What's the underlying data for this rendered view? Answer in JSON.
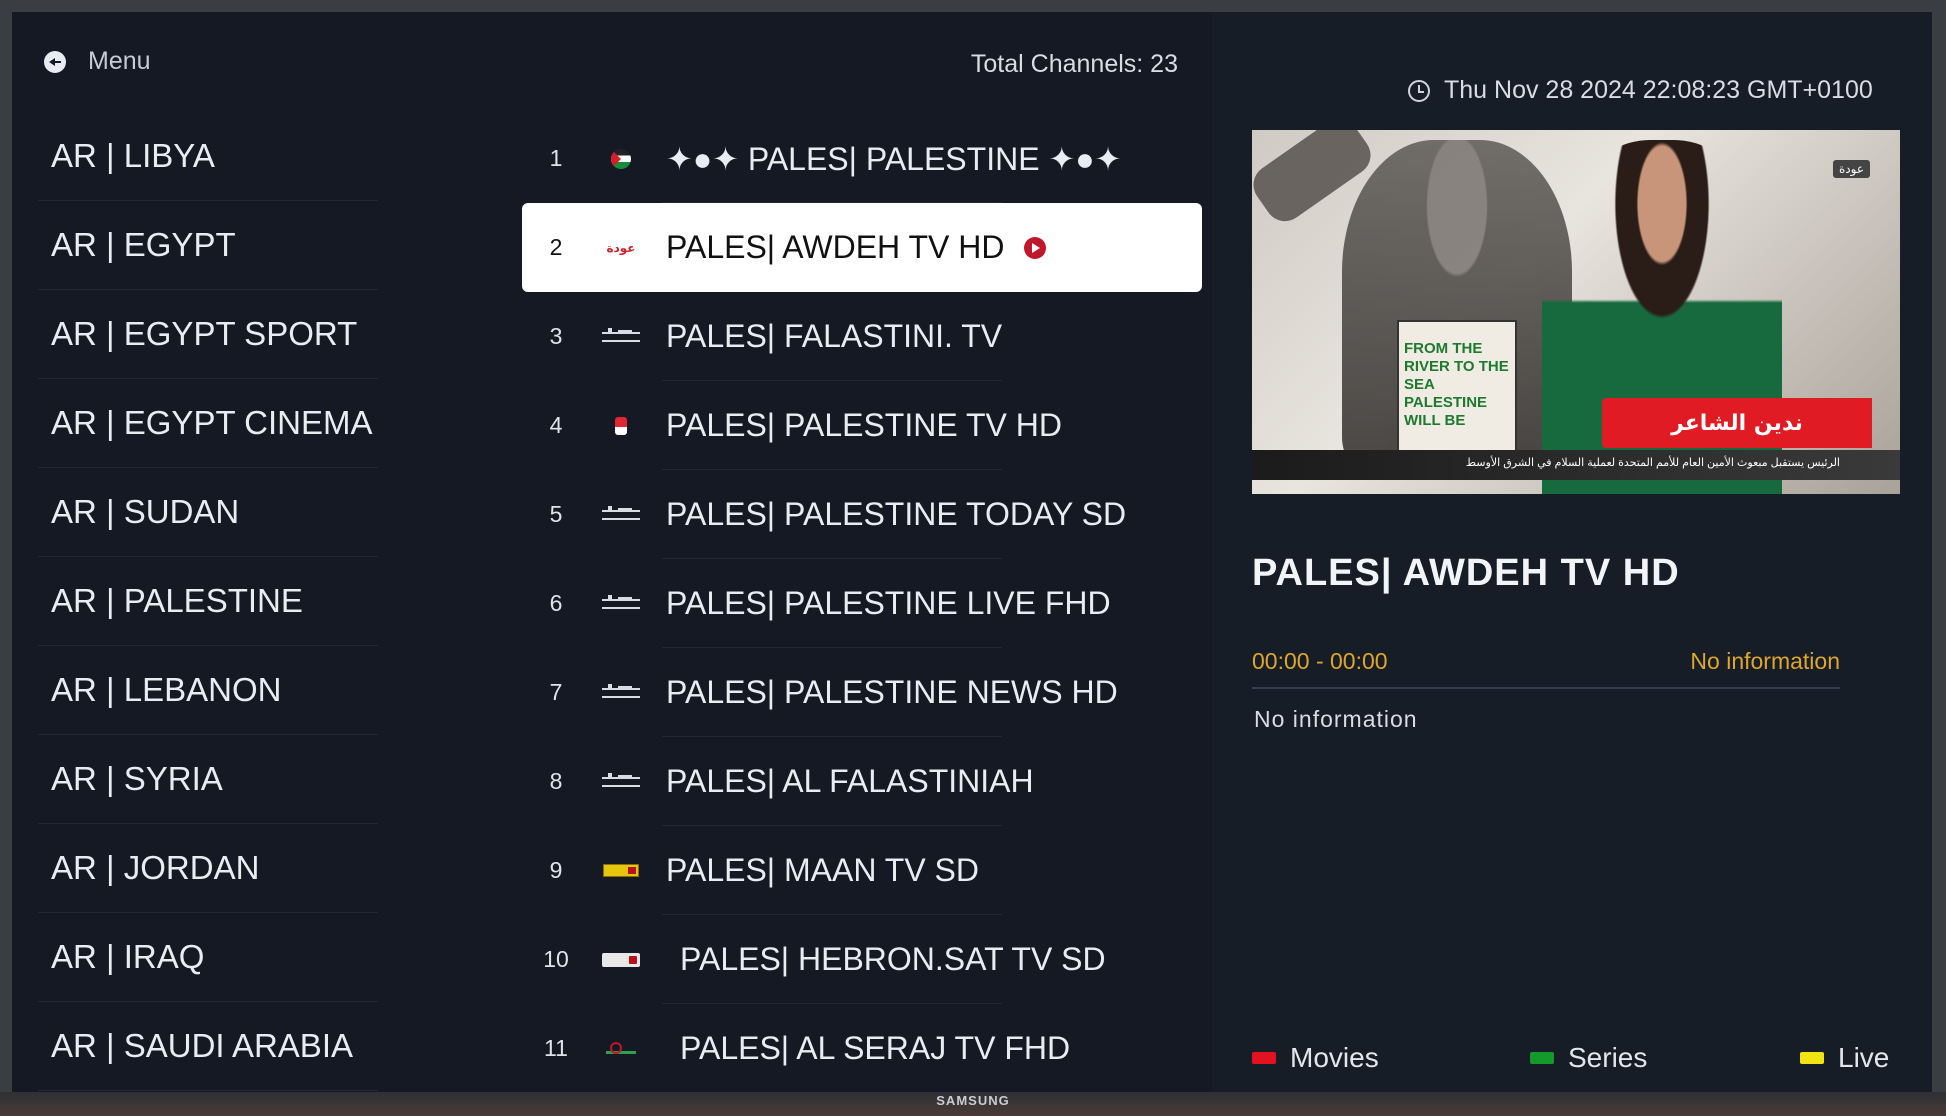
{
  "colors": {
    "movies": "#e3121f",
    "series": "#139a2a",
    "live": "#f2e312",
    "play": "#c0182a",
    "accent_time": "#e0a62b"
  },
  "bezel": {
    "brand": "SAMSUNG"
  },
  "categories": {
    "menu_label": "Menu",
    "items": [
      {
        "label": "AR | LIBYA"
      },
      {
        "label": "AR | EGYPT"
      },
      {
        "label": "AR | EGYPT SPORT"
      },
      {
        "label": "AR | EGYPT CINEMA"
      },
      {
        "label": "AR | SUDAN"
      },
      {
        "label": "AR | PALESTINE"
      },
      {
        "label": "AR | LEBANON"
      },
      {
        "label": "AR | SYRIA"
      },
      {
        "label": "AR | JORDAN"
      },
      {
        "label": "AR | IRAQ"
      },
      {
        "label": "AR | SAUDI ARABIA"
      }
    ]
  },
  "channels": {
    "total_label": "Total Channels: 23",
    "items": [
      {
        "num": "1",
        "name": "✦●✦ PALES| PALESTINE ✦●✦",
        "logo": "palestine-flag-icon"
      },
      {
        "num": "2",
        "name": "PALES| AWDEH TV HD",
        "logo": "awdeh-logo",
        "selected": true
      },
      {
        "num": "3",
        "name": "PALES| FALASTINI. TV",
        "logo": "falastini-logo"
      },
      {
        "num": "4",
        "name": "PALES| PALESTINE TV HD",
        "logo": "palestine-tv-logo"
      },
      {
        "num": "5",
        "name": "PALES| PALESTINE TODAY SD",
        "logo": "falastini-logo"
      },
      {
        "num": "6",
        "name": "PALES| PALESTINE LIVE FHD",
        "logo": "falastini-logo"
      },
      {
        "num": "7",
        "name": "PALES| PALESTINE NEWS HD",
        "logo": "falastini-logo"
      },
      {
        "num": "8",
        "name": "PALES| AL FALASTINIAH",
        "logo": "falastini-logo"
      },
      {
        "num": "9",
        "name": "PALES| MAAN TV SD",
        "logo": "maan-logo"
      },
      {
        "num": "10",
        "name": "PALES| HEBRON.SAT TV SD",
        "logo": "hebron-logo"
      },
      {
        "num": "11",
        "name": "PALES| AL SERAJ TV FHD",
        "logo": "seraj-logo"
      }
    ],
    "logo_texts": {
      "awdeh": "عودة"
    }
  },
  "detail": {
    "datetime": "Thu Nov 28 2024 22:08:23 GMT+0100",
    "channel_title": "PALES| AWDEH TV HD",
    "epg_time": "00:00 - 00:00",
    "epg_title": "No information",
    "epg_desc": "No information",
    "preview": {
      "name_banner": "ندين الشاعر",
      "sign_text": "FROM THE RIVER TO THE SEA PALESTINE WILL BE",
      "corner_tag": "عودة",
      "ticker": "الرئيس يستقبل مبعوث الأمين العام للأمم المتحدة لعملية السلام في الشرق الأوسط"
    }
  },
  "legend": [
    {
      "label": "Movies",
      "color_key": "movies"
    },
    {
      "label": "Series",
      "color_key": "series"
    },
    {
      "label": "Live",
      "color_key": "live"
    }
  ]
}
